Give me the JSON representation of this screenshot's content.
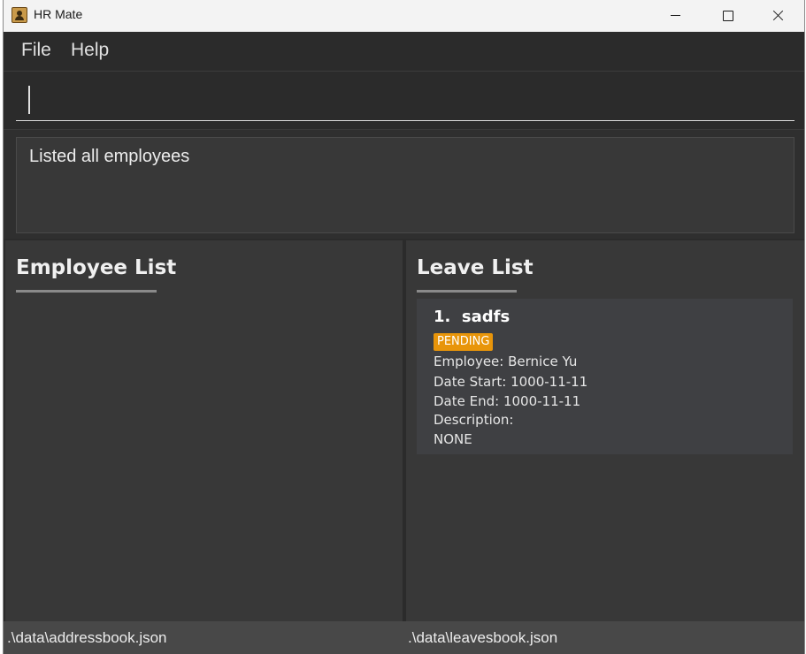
{
  "window": {
    "title": "HR Mate"
  },
  "menu": {
    "file_label": "File",
    "help_label": "Help"
  },
  "command": {
    "value": "",
    "placeholder": ""
  },
  "result": {
    "message": "Listed all employees"
  },
  "employee_panel": {
    "title": "Employee List",
    "items": []
  },
  "leave_panel": {
    "title": "Leave List",
    "items": [
      {
        "title": "1.  sadfs",
        "status": "PENDING",
        "employee": "Employee: Bernice Yu",
        "date_start": "Date Start: 1000-11-11",
        "date_end": "Date End: 1000-11-11",
        "description_label": "Description:",
        "description": "NONE"
      }
    ]
  },
  "status_bar": {
    "employee_path": ".\\data\\addressbook.json",
    "leave_path": ".\\data\\leavesbook.json"
  },
  "colors": {
    "background": "#383838",
    "badge_pending": "#e8950a",
    "card": "#3f4043",
    "status_bar": "#484848"
  }
}
